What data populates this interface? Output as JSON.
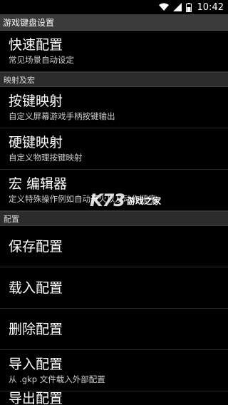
{
  "status_bar": {
    "time": "10:42",
    "icons": [
      "wifi-icon",
      "signal-icon",
      "battery-icon"
    ]
  },
  "title_bar": {
    "title": "游戏键盘设置"
  },
  "sections": {
    "quick": {
      "item": {
        "title": "快速配置",
        "subtitle": "常见场景自动设定"
      }
    },
    "mapping": {
      "header": "映射及宏",
      "items": [
        {
          "title": "按键映射",
          "subtitle": "自定义屏幕游戏手柄按键输出"
        },
        {
          "title": "硬键映射",
          "subtitle": "自定义物理按键映射"
        },
        {
          "title": "宏 编辑器",
          "subtitle": "定义特殊操作例如自动开火以及动作顺序"
        }
      ]
    },
    "config": {
      "header": "配置",
      "items": [
        {
          "title": "保存配置"
        },
        {
          "title": "载入配置"
        },
        {
          "title": "删除配置"
        },
        {
          "title": "导入配置",
          "subtitle": "从 .gkp 文件载入外部配置"
        },
        {
          "title": "导出配置"
        }
      ]
    }
  },
  "watermark": {
    "logo": "K73",
    "text": "游戏之家"
  }
}
